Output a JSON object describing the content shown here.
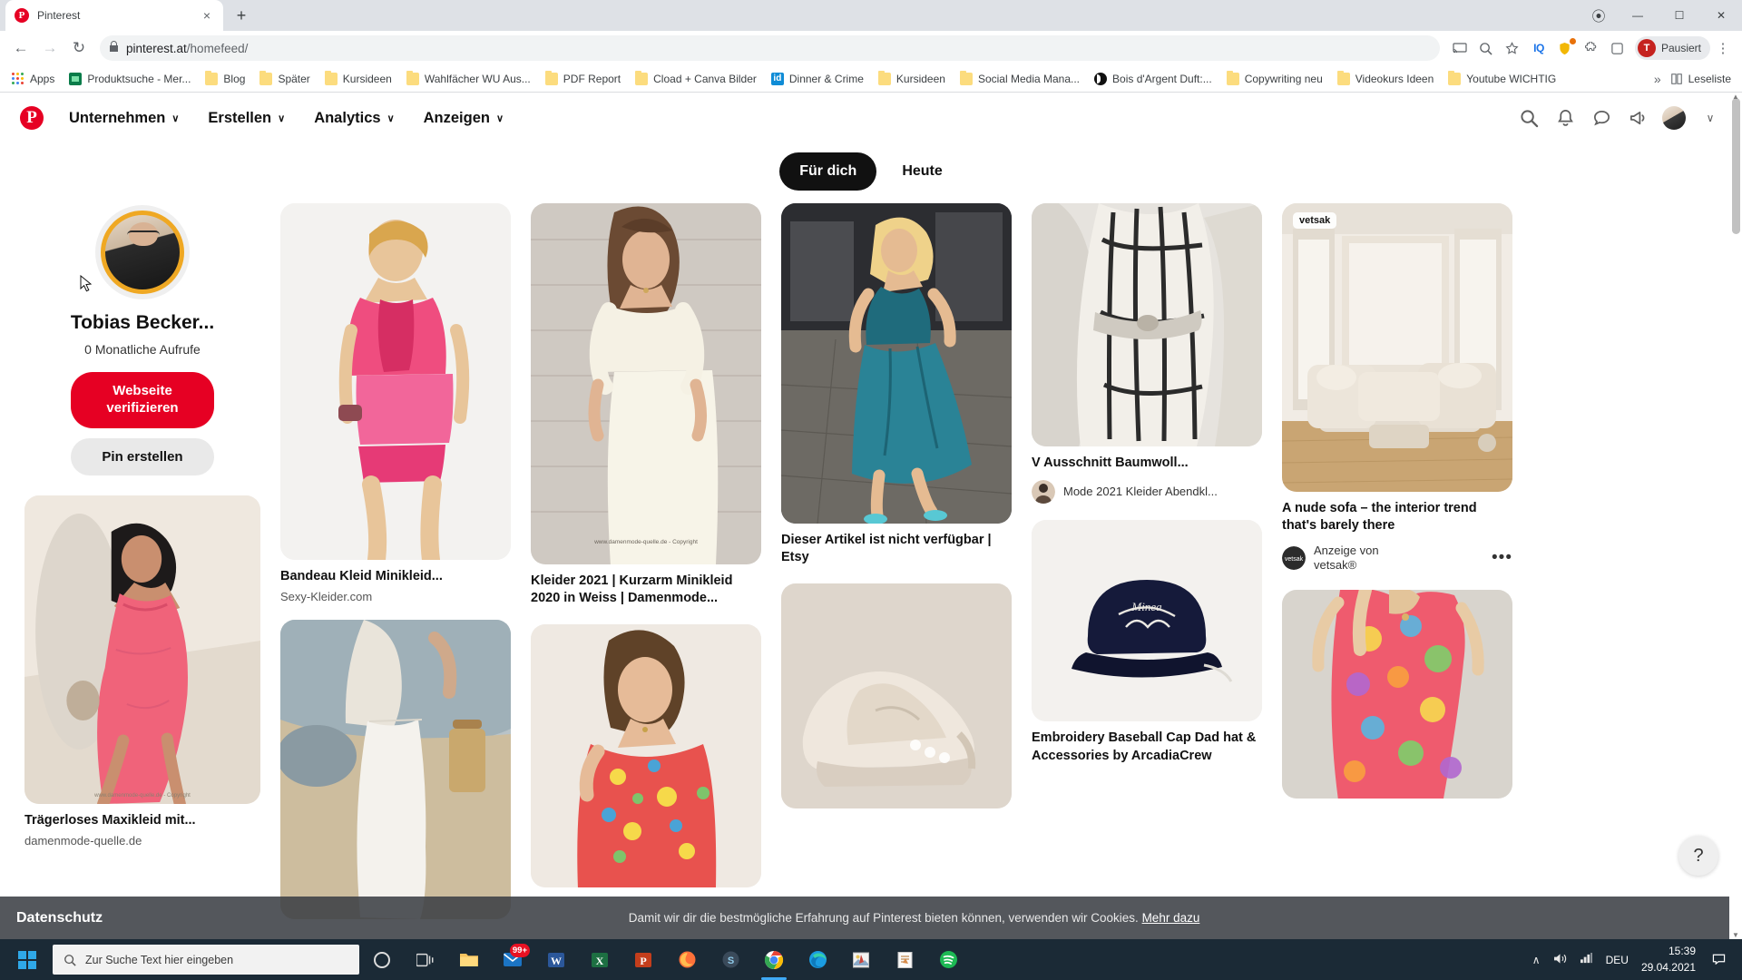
{
  "browser": {
    "tab": {
      "title": "Pinterest",
      "favicon": "pinterest-icon",
      "close": "×"
    },
    "new_tab_label": "+",
    "window_controls": {
      "extension": "⦿",
      "minimize": "—",
      "maximize": "☐",
      "close": "✕"
    },
    "nav": {
      "back": "←",
      "forward": "→",
      "reload": "↻"
    },
    "url": {
      "lock": "🔒",
      "domain": "pinterest.at",
      "path": "/homefeed/"
    },
    "omni_icons": [
      "cast-icon",
      "zoom-icon",
      "bookmark-star-icon",
      "iq-extension-icon",
      "extension-puzzle-icon",
      "shield-icon"
    ],
    "iq_label": "IQ",
    "profile": {
      "initial": "T",
      "label": "Pausiert"
    },
    "menu": "⋮",
    "bookmarks": [
      {
        "label": "Apps",
        "icon": "apps-grid-icon"
      },
      {
        "label": "Produktsuche - Mer...",
        "icon": "green-site-icon"
      },
      {
        "label": "Blog",
        "icon": "folder-icon"
      },
      {
        "label": "Später",
        "icon": "folder-icon"
      },
      {
        "label": "Kursideen",
        "icon": "folder-icon"
      },
      {
        "label": "Wahlfächer WU Aus...",
        "icon": "folder-icon"
      },
      {
        "label": "PDF Report",
        "icon": "folder-icon"
      },
      {
        "label": "Cload + Canva Bilder",
        "icon": "folder-icon"
      },
      {
        "label": "Dinner & Crime",
        "icon": "blue-site-icon"
      },
      {
        "label": "Kursideen",
        "icon": "folder-icon"
      },
      {
        "label": "Social Media Mana...",
        "icon": "folder-icon"
      },
      {
        "label": "Bois d'Argent Duft:...",
        "icon": "black-site-icon"
      },
      {
        "label": "Copywriting neu",
        "icon": "folder-icon"
      },
      {
        "label": "Videokurs Ideen",
        "icon": "folder-icon"
      },
      {
        "label": "Youtube WICHTIG",
        "icon": "folder-icon"
      }
    ],
    "bookmarks_overflow": "»",
    "reading_list": {
      "label": "Leseliste",
      "icon": "reading-list-icon"
    }
  },
  "pinterest": {
    "logo": "P",
    "nav": [
      {
        "label": "Unternehmen",
        "chevron": "∨"
      },
      {
        "label": "Erstellen",
        "chevron": "∨"
      },
      {
        "label": "Analytics",
        "chevron": "∨"
      },
      {
        "label": "Anzeigen",
        "chevron": "∨"
      }
    ],
    "header_icons": [
      "search-icon",
      "bell-icon",
      "chat-icon",
      "megaphone-icon"
    ],
    "account_chevron": "∨",
    "tabs": [
      {
        "label": "Für dich",
        "active": true
      },
      {
        "label": "Heute",
        "active": false
      }
    ],
    "profile_card": {
      "name": "Tobias Becker...",
      "stat": "0 Monatliche Aufrufe",
      "primary_button": "Webseite verifizieren",
      "secondary_button": "Pin erstellen"
    },
    "pins": [
      {
        "id": "traegerloses-maxikleid",
        "title": "Trägerloses Maxikleid mit...",
        "subtitle": "damenmode-quelle.de"
      },
      {
        "id": "bandeau-kleid",
        "title": "Bandeau Kleid Minikleid...",
        "subtitle": "Sexy-Kleider.com"
      },
      {
        "id": "white-pants",
        "title": "",
        "subtitle": ""
      },
      {
        "id": "kleider-2021",
        "title": "Kleider 2021 | Kurzarm Minikleid 2020 in Weiss | Damenmode...",
        "subtitle": ""
      },
      {
        "id": "floral-off-shoulder",
        "title": "",
        "subtitle": ""
      },
      {
        "id": "etsy-teal-dress",
        "title": "Dieser Artikel ist nicht verfügbar | Etsy",
        "subtitle": ""
      },
      {
        "id": "nike-sneakers",
        "title": "",
        "subtitle": ""
      },
      {
        "id": "v-ausschnitt",
        "title": "V Ausschnitt Baumwoll...",
        "attrib_name": "Mode 2021 Kleider Abendkl..."
      },
      {
        "id": "baseball-cap",
        "title": "Embroidery Baseball Cap Dad hat & Accessories by ArcadiaCrew",
        "subtitle": ""
      },
      {
        "id": "vetsak-sofa",
        "badge": "vetsak",
        "title": "A nude sofa – the interior trend that's barely there",
        "attrib_label": "Anzeige von",
        "attrib_name": "vetsak®",
        "more": "•••"
      },
      {
        "id": "floral-blouse",
        "title": "",
        "subtitle": ""
      }
    ],
    "help_button": "?",
    "cookie_banner": {
      "left": "Datenschutz",
      "text": "Damit wir dir die bestmögliche Erfahrung auf Pinterest bieten können, verwenden wir Cookies.",
      "link": "Mehr dazu"
    }
  },
  "taskbar": {
    "start": "windows-start-icon",
    "search_placeholder": "Zur Suche Text hier eingeben",
    "items": [
      {
        "name": "cortana-icon",
        "badge": ""
      },
      {
        "name": "task-view-icon",
        "badge": ""
      },
      {
        "name": "file-explorer-icon",
        "badge": ""
      },
      {
        "name": "mail-icon",
        "badge": "99+"
      },
      {
        "name": "word-icon",
        "badge": ""
      },
      {
        "name": "excel-icon",
        "badge": ""
      },
      {
        "name": "powerpoint-icon",
        "badge": ""
      },
      {
        "name": "firefox-icon",
        "badge": ""
      },
      {
        "name": "skype-icon",
        "badge": ""
      },
      {
        "name": "chrome-icon",
        "badge": ""
      },
      {
        "name": "edge-icon",
        "badge": ""
      },
      {
        "name": "photos-icon",
        "badge": ""
      },
      {
        "name": "reader-icon",
        "badge": ""
      },
      {
        "name": "spotify-icon",
        "badge": ""
      }
    ],
    "tray": {
      "chevron": "∧",
      "volume": "🔊",
      "network": "◢",
      "language": "DEU",
      "time": "15:39",
      "date": "29.04.2021",
      "notifications": "□"
    }
  },
  "colors": {
    "pinterest_red": "#e60023",
    "chrome_tabstrip": "#dee1e6",
    "taskbar": "#1b2a36",
    "avatar_ring": "#efa823",
    "accent_blue": "#3fa9f5"
  }
}
